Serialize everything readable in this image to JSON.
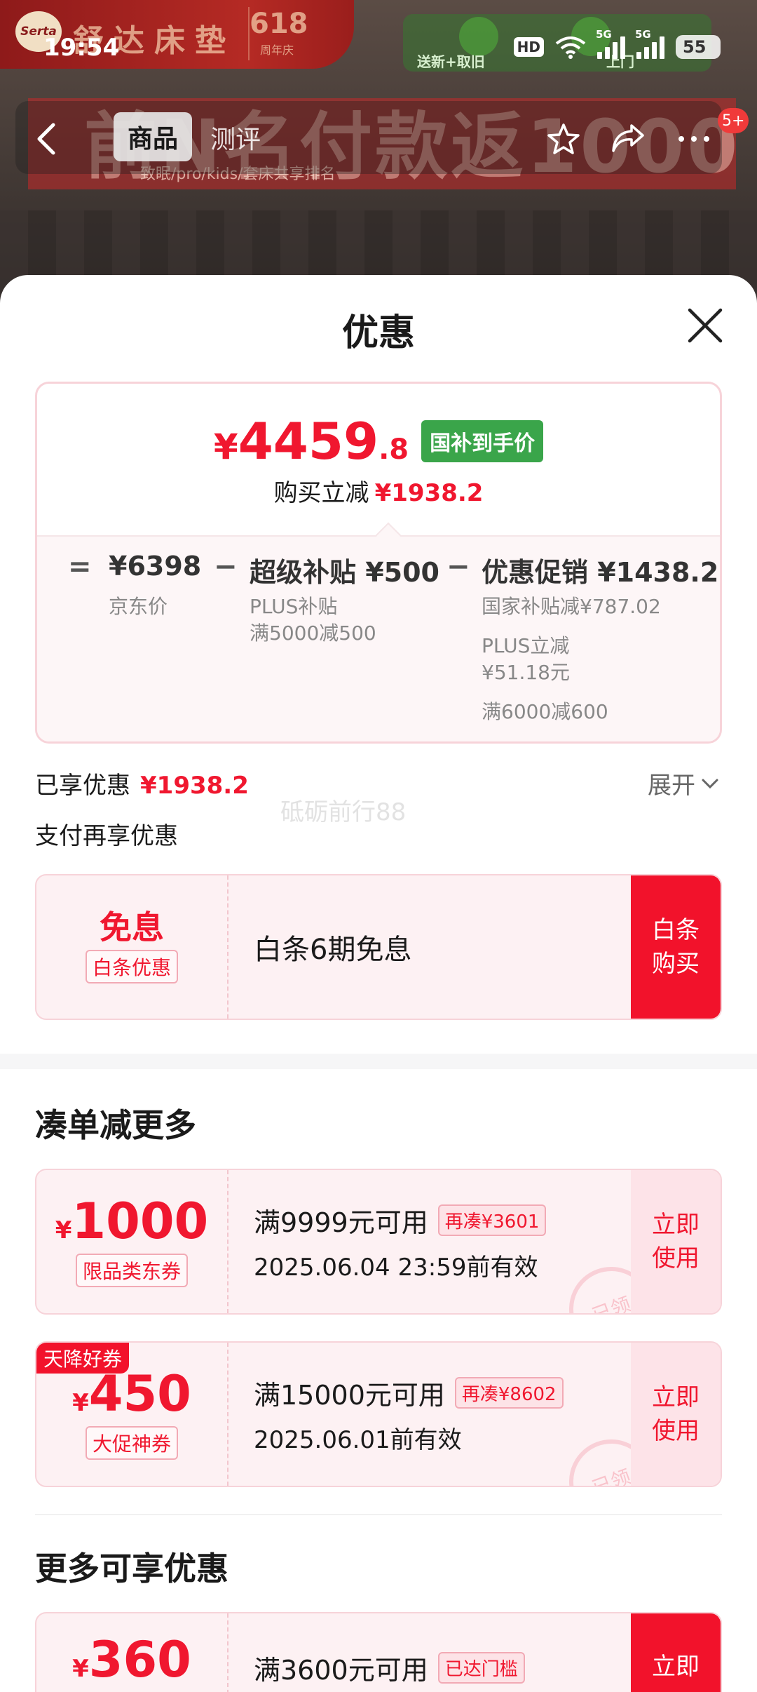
{
  "status_bar": {
    "time": "19:54",
    "hd": "HD",
    "net1": "5G",
    "net2": "5G",
    "battery": "55"
  },
  "background": {
    "brand_logo": "Serta",
    "brand_name": "舒达床垫",
    "anniversary_number": "618",
    "anniversary_text": "周年庆",
    "green_banner_sub1": "送新+取旧",
    "green_banner_sub2": "上门",
    "promo_big": "前N名付款返1000",
    "promo_sub": "致眠/pro/kids/套床共享排名"
  },
  "nav": {
    "tab_goods": "商品",
    "tab_review": "测评",
    "more_badge": "5+"
  },
  "sheet": {
    "title": "优惠",
    "final_price": {
      "yen": "¥",
      "int": "4459",
      "dec": ".8"
    },
    "final_tag": "国补到手价",
    "reduce_label": "购买立减",
    "reduce_value": "¥1938.2",
    "breakdown": {
      "op_equal": "=",
      "op_minus": "−",
      "jd_price": "¥6398",
      "jd_price_label": "京东价",
      "super_head": "超级补贴 ¥500",
      "super_sub1": "PLUS补贴",
      "super_sub2": "满5000减500",
      "promo_head": "优惠促销 ¥1438.2",
      "promo_sub1": "国家补贴减¥787.02",
      "promo_sub2": "PLUS立减",
      "promo_sub3": "¥51.18元",
      "promo_sub4": "满6000减600"
    },
    "enjoyed_label": "已享优惠",
    "enjoyed_value": "¥1938.2",
    "expand": "展开",
    "watermark": "砥砺前行88",
    "pay_more": "支付再享优惠",
    "baitiao": {
      "amount": "免息",
      "tag": "白条优惠",
      "desc": "白条6期免息",
      "action": "白条购买"
    },
    "section_more_reduce": "凑单减更多",
    "coupons": [
      {
        "yen": "¥",
        "value": "1000",
        "tag": "限品类东券",
        "cond": "满9999元可用",
        "extra": "再凑¥3601",
        "expiry": "2025.06.04 23:59前有效",
        "action": "立即使用",
        "stamp": "已领"
      },
      {
        "badge": "天降好券",
        "yen": "¥",
        "value": "450",
        "tag": "大促神券",
        "cond": "满15000元可用",
        "extra": "再凑¥8602",
        "expiry": "2025.06.01前有效",
        "action": "立即使用",
        "stamp": "已领"
      }
    ],
    "section_more_enjoy": "更多可享优惠",
    "coupon3": {
      "yen": "¥",
      "value": "360",
      "cond": "满3600元可用",
      "extra": "已达门槛",
      "action": "立即"
    }
  },
  "colors": {
    "accent_red": "#f0172f",
    "gov_green": "#3aa54a",
    "button_red": "#f2122b"
  },
  "icons": [
    "back-icon",
    "star-icon",
    "share-icon",
    "more-icon",
    "close-icon",
    "chevron-down-icon",
    "wifi-icon",
    "signal-icon"
  ]
}
